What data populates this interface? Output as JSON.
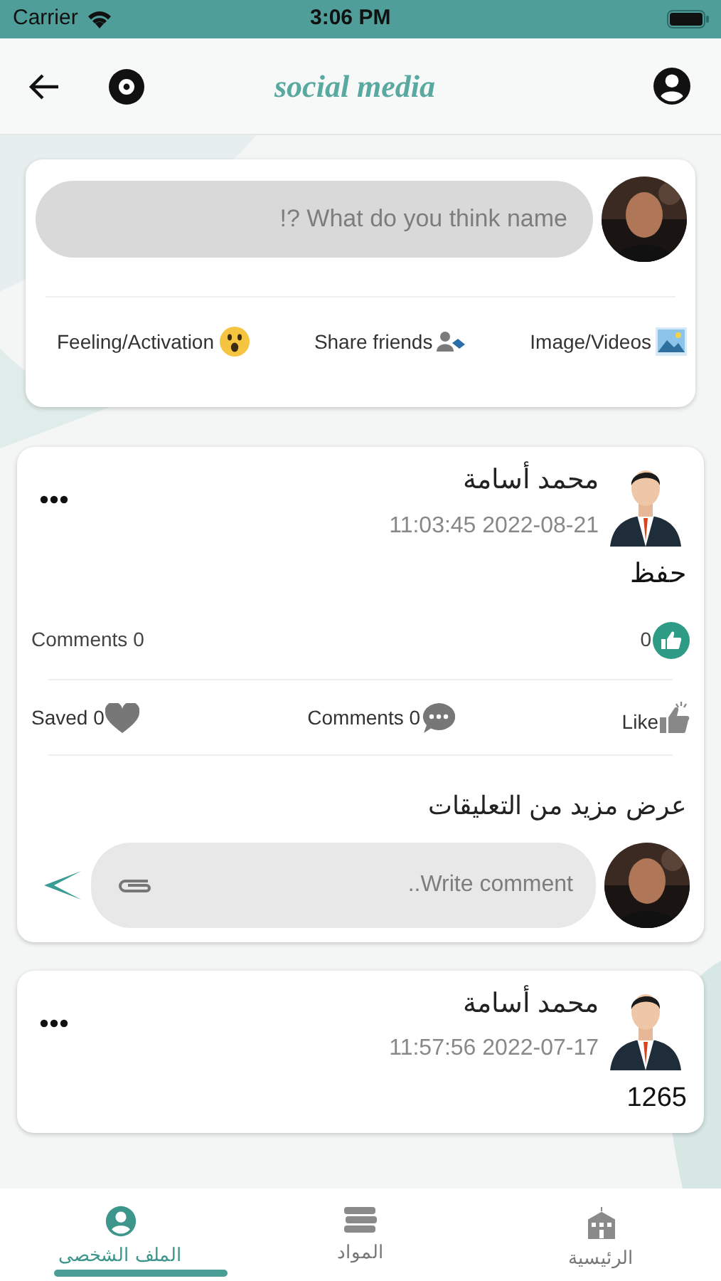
{
  "status_bar": {
    "carrier": "Carrier",
    "time": "3:06 PM"
  },
  "header": {
    "title": "social media"
  },
  "composer": {
    "placeholder": "!? What do you think name",
    "actions": [
      {
        "kind": "media",
        "label": "Image/Videos"
      },
      {
        "kind": "friends",
        "label": "Share friends"
      },
      {
        "kind": "feeling",
        "label": "Feeling/Activation"
      }
    ]
  },
  "posts": [
    {
      "author": "محمد أسامة",
      "time": "11:03:45 2022-08-21",
      "text": "حفظ",
      "likes": "0",
      "comments": "Comments 0",
      "actions": [
        {
          "kind": "like",
          "label": "Like"
        },
        {
          "kind": "comments",
          "label": "Comments 0"
        },
        {
          "kind": "saved",
          "label": "Saved 0"
        }
      ],
      "more_comments": "عرض مزيد من التعليقات",
      "comment_placeholder": "..Write comment"
    },
    {
      "author": "محمد أسامة",
      "time": "11:57:56 2022-07-17",
      "text": "1265"
    }
  ],
  "tabs": [
    {
      "kind": "home",
      "label": "الرئيسية",
      "selected": false
    },
    {
      "kind": "books",
      "label": "المواد",
      "selected": false
    },
    {
      "kind": "profile",
      "label": "الملف الشخصى",
      "selected": true
    }
  ]
}
